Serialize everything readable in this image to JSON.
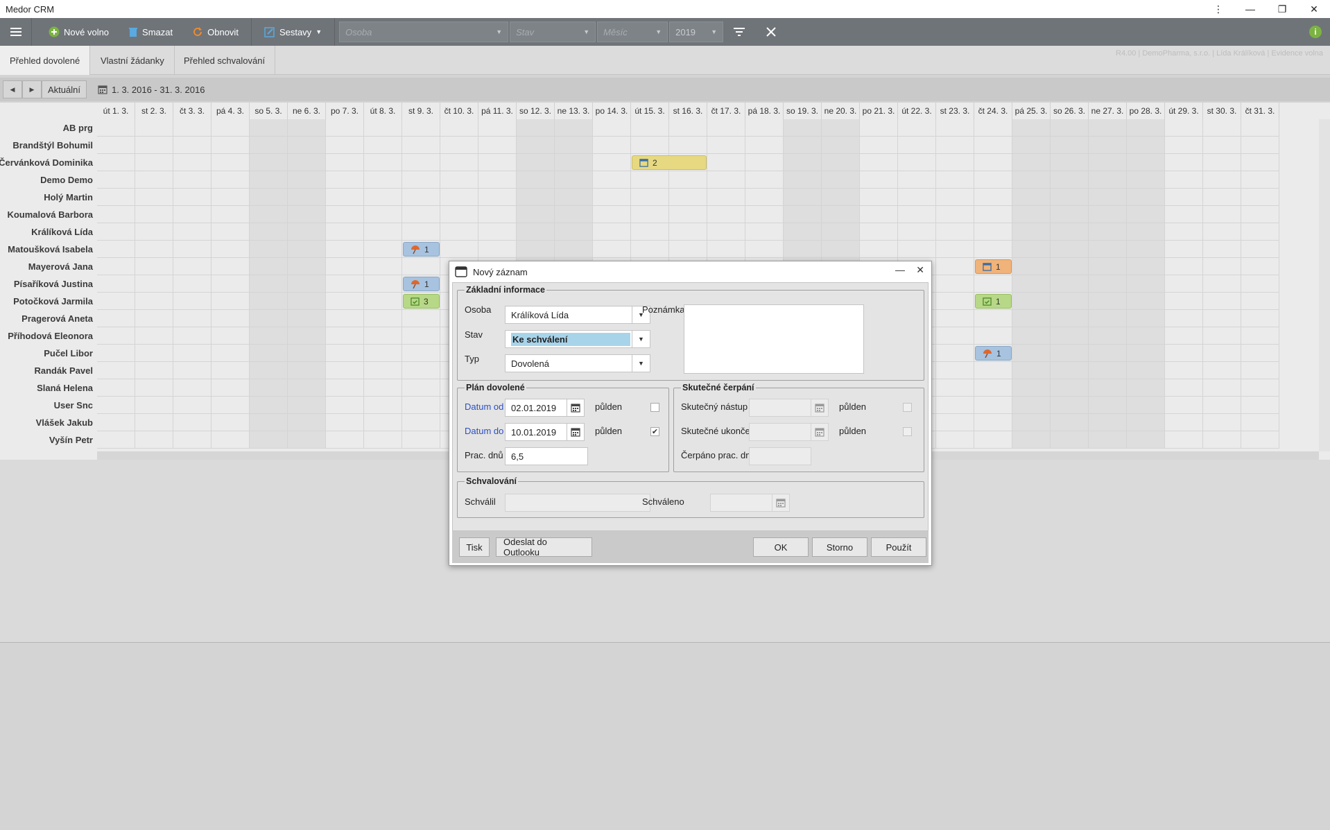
{
  "window": {
    "title": "Medor CRM",
    "controls": {
      "more": "⋮",
      "minimize": "—",
      "restore": "❐",
      "close": "✕"
    }
  },
  "toolbar": {
    "new_label": "Nové volno",
    "delete_label": "Smazat",
    "refresh_label": "Obnovit",
    "reports_label": "Sestavy",
    "filter_person_placeholder": "Osoba",
    "filter_state_placeholder": "Stav",
    "filter_month_placeholder": "Měsíc",
    "filter_year_value": "2019"
  },
  "tabs": [
    {
      "label": "Přehled dovolené",
      "active": true
    },
    {
      "label": "Vlastní žádanky",
      "active": false
    },
    {
      "label": "Přehled schvalování",
      "active": false
    }
  ],
  "tabs_info": "R4.00 | DemoPharma, s.r.o. | Lída Králíková | Evidence volna",
  "datebar": {
    "today_label": "Aktuální",
    "range": "1. 3. 2016 - 31. 3. 2016"
  },
  "days": [
    "út 1. 3.",
    "st 2. 3.",
    "čt 3. 3.",
    "pá 4. 3.",
    "so 5. 3.",
    "ne 6. 3.",
    "po 7. 3.",
    "út 8. 3.",
    "st 9. 3.",
    "čt 10. 3.",
    "pá 11. 3.",
    "so 12. 3.",
    "ne 13. 3.",
    "po 14. 3.",
    "út 15. 3.",
    "st 16. 3.",
    "čt 17. 3.",
    "pá 18. 3.",
    "so 19. 3.",
    "ne 20. 3.",
    "po 21. 3.",
    "út 22. 3.",
    "st 23. 3.",
    "čt 24. 3.",
    "pá 25. 3.",
    "so 26. 3.",
    "ne 27. 3.",
    "po 28. 3.",
    "út 29. 3.",
    "st 30. 3.",
    "čt 31. 3."
  ],
  "weekend_index": [
    4,
    5,
    11,
    12,
    18,
    19,
    24,
    25,
    26,
    27
  ],
  "people": [
    "AB prg",
    "Brandštýl Bohumil",
    "Červánková Dominika",
    "Demo Demo",
    "Holý Martin",
    "Koumalová Barbora",
    "Králíková Lída",
    "Matoušková Isabela",
    "Mayerová Jana",
    "Písaříková Justina",
    "Potočková Jarmila",
    "Pragerová Aneta",
    "Příhodová Eleonora",
    "Pučel Libor",
    "Randák Pavel",
    "Slaná Helena",
    "User Snc",
    "Vlášek Jakub",
    "Vyšín Petr"
  ],
  "entries": [
    {
      "row": 2,
      "start": 14,
      "span": 2,
      "color": "yellow",
      "icon": "calendar-icon",
      "count": "2"
    },
    {
      "row": 7,
      "start": 8,
      "span": 1,
      "color": "blue",
      "icon": "beach-umbrella-icon",
      "count": "1"
    },
    {
      "row": 8,
      "start": 23,
      "span": 1,
      "color": "orange",
      "icon": "calendar-icon",
      "count": "1"
    },
    {
      "row": 9,
      "start": 8,
      "span": 1,
      "color": "blue",
      "icon": "beach-umbrella-icon",
      "count": "1"
    },
    {
      "row": 10,
      "start": 8,
      "span": 1,
      "color": "green",
      "icon": "calendar-check-icon",
      "count": "3"
    },
    {
      "row": 10,
      "start": 23,
      "span": 1,
      "color": "green",
      "icon": "calendar-check-icon",
      "count": "1"
    },
    {
      "row": 13,
      "start": 23,
      "span": 1,
      "color": "blue",
      "icon": "beach-umbrella-icon",
      "count": "1"
    }
  ],
  "dialog": {
    "title": "Nový záznam",
    "basic": {
      "legend": "Základní informace",
      "person_label": "Osoba",
      "person_value": "Králíková Lída",
      "state_label": "Stav",
      "state_value": "Ke schválení",
      "type_label": "Typ",
      "type_value": "Dovolená",
      "note_label": "Poznámka"
    },
    "plan": {
      "legend": "Plán dovolené",
      "from_label": "Datum od",
      "from_value": "02.01.2019",
      "to_label": "Datum do",
      "to_value": "10.01.2019",
      "half_label": "půlden",
      "from_half_checked": false,
      "to_half_checked": true,
      "days_label": "Prac. dnů",
      "days_value": "6,5"
    },
    "actual": {
      "legend": "Skutečné čerpání",
      "start_label": "Skutečný nástup",
      "end_label": "Skutečné ukončení",
      "half_label": "půlden",
      "used_label": "Čerpáno prac. dnů"
    },
    "approval": {
      "legend": "Schvalování",
      "approver_label": "Schválil",
      "approved_label": "Schváleno"
    },
    "footer": {
      "print": "Tisk",
      "outlook": "Odeslat do Outlooku",
      "ok": "OK",
      "cancel": "Storno",
      "apply": "Použít"
    }
  },
  "colors": {
    "toolbar": "#6f7479",
    "label_blue": "#2b4fc4",
    "selection": "#a8d4ea",
    "info_green": "#7cb342"
  }
}
